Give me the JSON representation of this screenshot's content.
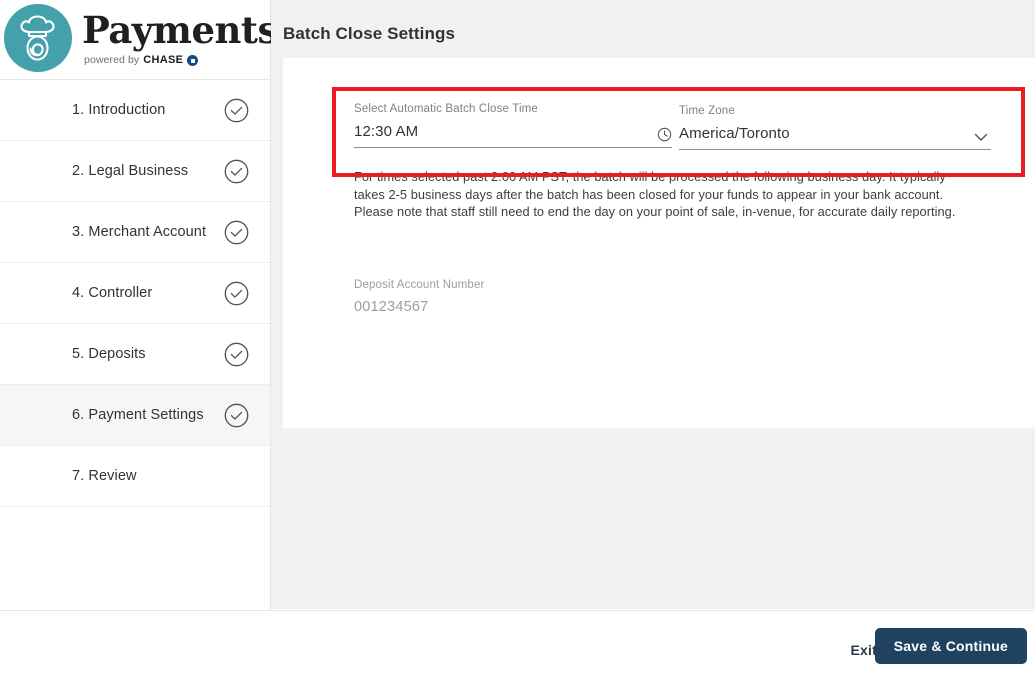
{
  "brand": {
    "title": "Payments",
    "powered_by": "powered by",
    "partner": "CHASE",
    "logo_icon": "chef-hat-fingerprint-logo",
    "logo_color": "#44a0ab",
    "partner_mark_color": "#0f4a8a"
  },
  "sidebar": {
    "items": [
      {
        "label": "1. Introduction",
        "complete": true,
        "active": false,
        "icon": "check-circle-icon"
      },
      {
        "label": "2. Legal Business",
        "complete": true,
        "active": false,
        "icon": "check-circle-icon"
      },
      {
        "label": "3. Merchant Account",
        "complete": true,
        "active": false,
        "icon": "check-circle-icon"
      },
      {
        "label": "4. Controller",
        "complete": true,
        "active": false,
        "icon": "check-circle-icon"
      },
      {
        "label": "5. Deposits",
        "complete": true,
        "active": false,
        "icon": "check-circle-icon"
      },
      {
        "label": "6. Payment Settings",
        "complete": true,
        "active": true,
        "icon": "check-circle-icon"
      },
      {
        "label": "7. Review",
        "complete": false,
        "active": false,
        "icon": ""
      }
    ]
  },
  "main": {
    "page_title": "Batch Close Settings",
    "batch_close_time": {
      "label": "Select Automatic Batch Close Time",
      "value": "12:30 AM",
      "icon": "clock-icon"
    },
    "time_zone": {
      "label": "Time Zone",
      "value": "America/Toronto",
      "icon": "chevron-down-icon"
    },
    "helper_text": "For times selected past 2:00 AM PST, the batch will be processed the following business day. It typically takes 2-5 business days after the batch has been closed for your funds to appear in your bank account. Please note that staff still need to end the day on your point of sale, in-venue, for accurate daily reporting.",
    "deposit_account": {
      "label": "Deposit Account Number",
      "value": "001234567"
    },
    "highlight_color": "#ed1c24"
  },
  "footer": {
    "exit_label": "Exit",
    "save_label": "Save & Continue",
    "primary_color": "#1f4260"
  }
}
